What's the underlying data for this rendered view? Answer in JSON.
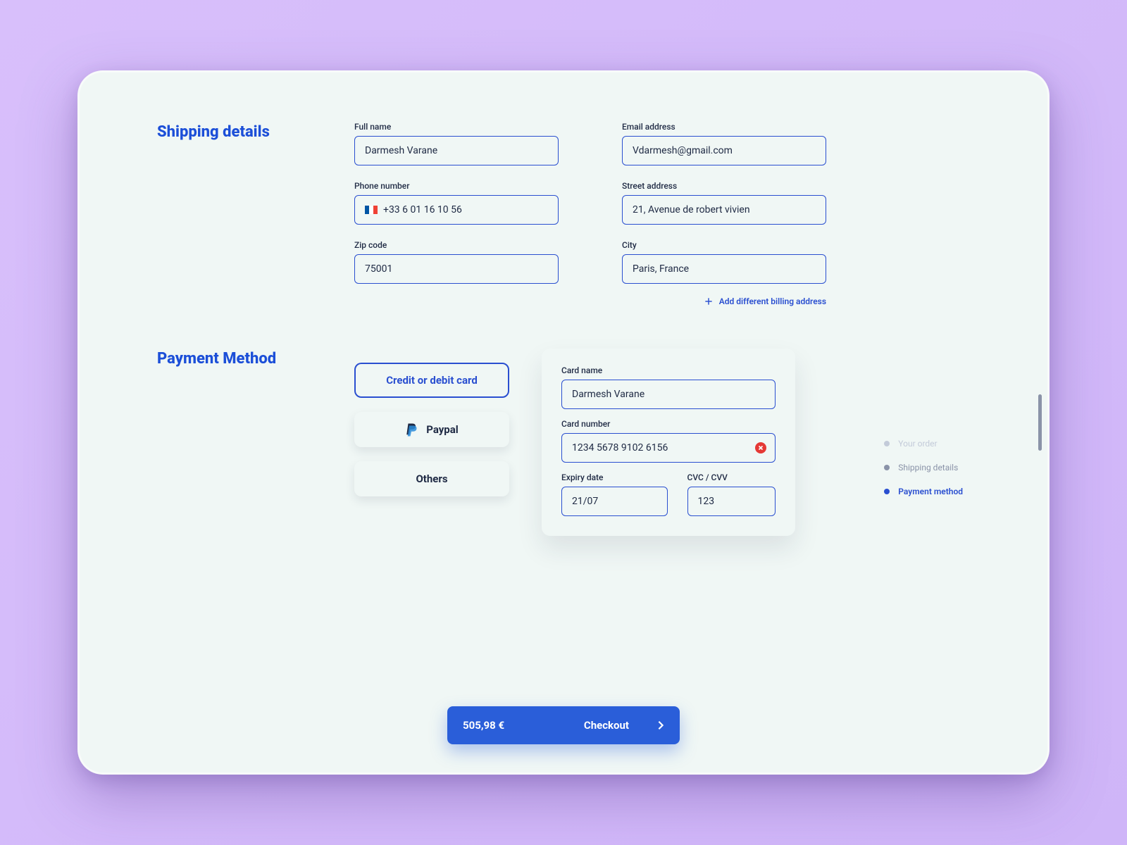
{
  "shipping": {
    "title": "Shipping details",
    "full_name": {
      "label": "Full name",
      "value": "Darmesh Varane"
    },
    "email": {
      "label": "Email address",
      "value": "Vdarmesh@gmail.com"
    },
    "phone": {
      "label": "Phone number",
      "value": "+33 6 01 16 10 56"
    },
    "street": {
      "label": "Street address",
      "value": "21, Avenue de robert vivien"
    },
    "zip": {
      "label": "Zip code",
      "value": "75001"
    },
    "city": {
      "label": "City",
      "value": "Paris, France"
    },
    "add_billing": "Add different billing address"
  },
  "payment": {
    "title": "Payment Method",
    "tabs": {
      "credit": "Credit or debit card",
      "paypal": "Paypal",
      "others": "Others"
    },
    "card_name": {
      "label": "Card name",
      "value": "Darmesh Varane"
    },
    "card_number": {
      "label": "Card number",
      "value": "1234 5678 9102 6156"
    },
    "expiry": {
      "label": "Expiry date",
      "value": "21/07"
    },
    "cvc": {
      "label": "CVC / CVV",
      "value": "123"
    }
  },
  "progress": {
    "your_order": "Your order",
    "shipping": "Shipping details",
    "payment": "Payment method"
  },
  "checkout": {
    "total": "505,98 €",
    "label": "Checkout"
  }
}
